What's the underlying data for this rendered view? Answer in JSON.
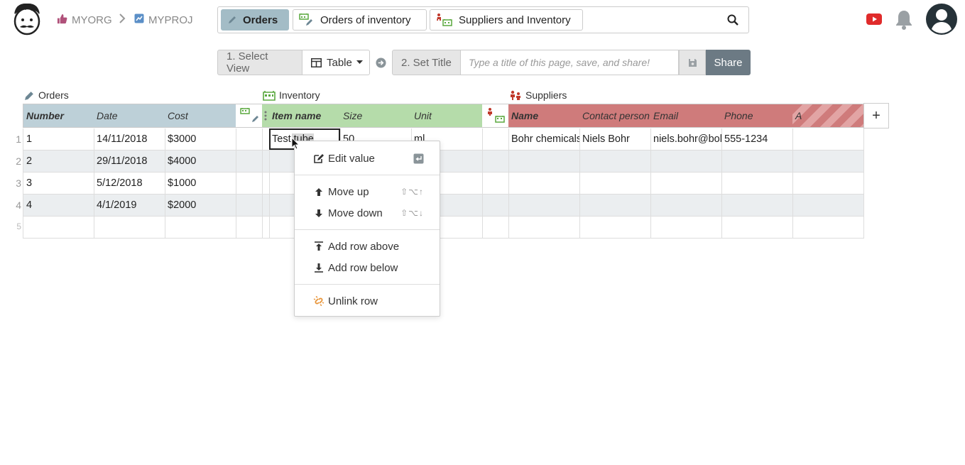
{
  "breadcrumb": {
    "org": "MYORG",
    "project": "MYPROJ"
  },
  "tabs": [
    {
      "label": "Orders",
      "active": true
    },
    {
      "label": "Orders of inventory",
      "active": false
    },
    {
      "label": "Suppliers and Inventory",
      "active": false
    }
  ],
  "toolbar": {
    "select_view_label": "1. Select View",
    "view_value": "Table",
    "set_title_label": "2. Set Title",
    "title_placeholder": "Type a title of this page, save, and share!",
    "share_label": "Share"
  },
  "groups": {
    "orders": "Orders",
    "inventory": "Inventory",
    "suppliers": "Suppliers"
  },
  "columns": {
    "number": "Number",
    "date": "Date",
    "cost": "Cost",
    "item_name": "Item name",
    "size": "Size",
    "unit": "Unit",
    "name": "Name",
    "contact": "Contact person",
    "email": "Email",
    "phone": "Phone",
    "a": "A"
  },
  "rows": [
    {
      "num": "1",
      "number": "1",
      "date": "14/11/2018",
      "cost": "$3000",
      "item_name": "Test tube",
      "size": "50",
      "unit": "ml",
      "name": "Bohr chemicals",
      "contact": "Niels Bohr",
      "email": "niels.bohr@bohr",
      "phone": "555-1234"
    },
    {
      "num": "2",
      "number": "2",
      "date": "29/11/2018",
      "cost": "$4000"
    },
    {
      "num": "3",
      "number": "3",
      "date": "5/12/2018",
      "cost": "$1000"
    },
    {
      "num": "4",
      "number": "4",
      "date": "4/1/2019",
      "cost": "$2000"
    },
    {
      "num": "5"
    }
  ],
  "context_menu": {
    "edit_value": "Edit value",
    "move_up": "Move up",
    "move_up_shortcut": "⇧⌥↑",
    "move_down": "Move down",
    "move_down_shortcut": "⇧⌥↓",
    "add_row_above": "Add row above",
    "add_row_below": "Add row below",
    "unlink_row": "Unlink row"
  },
  "add_column_label": "+",
  "colors": {
    "orders": "#bdd0d8",
    "inventory": "#b5dcaa",
    "suppliers": "#cf7b7b",
    "active_tab": "#a3bcc6",
    "share": "#6c7a84",
    "unlink": "#e8953a"
  }
}
